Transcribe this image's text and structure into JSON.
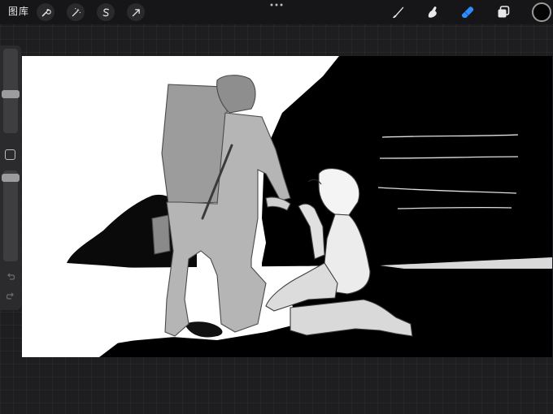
{
  "toolbar": {
    "gallery_label": "图库",
    "left_tools": [
      {
        "name": "actions",
        "icon": "wrench-icon"
      },
      {
        "name": "adjustments",
        "icon": "magic-wand-icon"
      },
      {
        "name": "selection",
        "icon": "selection-s-icon"
      },
      {
        "name": "transform",
        "icon": "arrow-cursor-icon"
      }
    ],
    "more_icon": "more-dots-icon",
    "right_tools": [
      {
        "name": "brush",
        "icon": "brush-icon",
        "active": false
      },
      {
        "name": "smudge",
        "icon": "smudge-icon",
        "active": false
      },
      {
        "name": "eraser",
        "icon": "eraser-icon",
        "active": true
      },
      {
        "name": "layers",
        "icon": "layers-icon",
        "active": false
      }
    ],
    "current_color": "#050505",
    "active_tool_color": "#2f8cff"
  },
  "sidebar": {
    "brush_size_level": 0.4,
    "opacity_level": 0.95,
    "modify_icon": "square-modify-icon",
    "undo_icon": "undo-icon",
    "redo_icon": "redo-icon"
  },
  "canvas": {
    "artwork": "sketch-astronaut-and-kneeling-figure"
  }
}
